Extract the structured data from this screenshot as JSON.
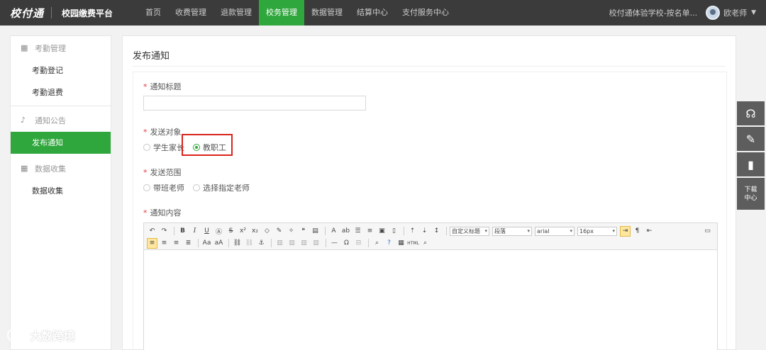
{
  "header": {
    "logo": "校付通",
    "platform": "校园缴费平台",
    "nav": [
      "首页",
      "收费管理",
      "退款管理",
      "校务管理",
      "数据管理",
      "结算中心",
      "支付服务中心"
    ],
    "active_nav_index": 3,
    "school": "校付通体验学校-按名单...",
    "user": "欧老师",
    "user_menu_icon": "chevron-down-icon"
  },
  "sidebar": {
    "groups": [
      {
        "title": "考勤管理",
        "icon": "grid-icon",
        "items": [
          "考勤登记",
          "考勤退费"
        ]
      },
      {
        "title": "通知公告",
        "icon": "bell-icon",
        "items": [
          "发布通知"
        ]
      },
      {
        "title": "数据收集",
        "icon": "grid-icon",
        "items": [
          "数据收集"
        ]
      }
    ],
    "active_item": "发布通知"
  },
  "main": {
    "title": "发布通知",
    "fields": {
      "notice_title_label": "通知标题",
      "notice_title_value": "",
      "send_target_label": "发送对象",
      "send_target_options": [
        "学生家长",
        "教职工"
      ],
      "send_target_selected": "教职工",
      "send_scope_label": "发送范围",
      "send_scope_options": [
        "带班老师",
        "选择指定老师"
      ],
      "content_label": "通知内容"
    },
    "editor": {
      "selects": {
        "heading": "自定义标题",
        "paragraph": "段落",
        "font": "arial",
        "size": "16px"
      }
    }
  },
  "float_panel": {
    "download_label_line1": "下载",
    "download_label_line2": "中心"
  },
  "watermark": "大数跨境",
  "colors": {
    "accent": "#2fa73c",
    "topbar": "#3b3b3b",
    "required": "#e4393c",
    "highlight": "#d9241d"
  }
}
